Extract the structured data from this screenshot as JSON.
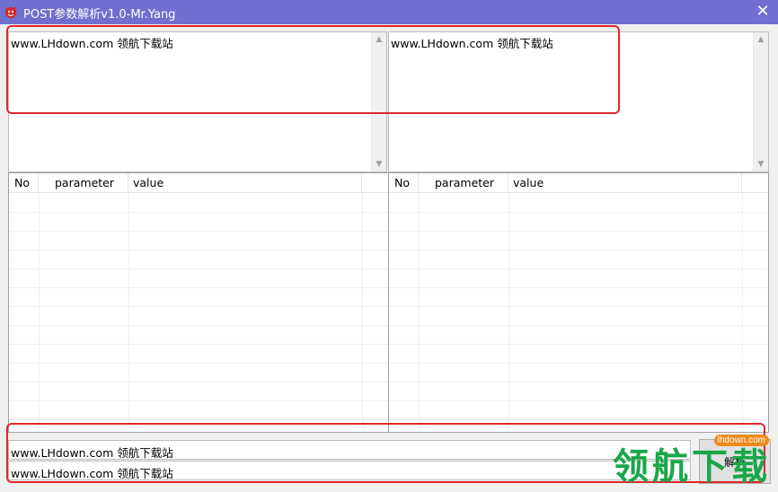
{
  "window": {
    "title": "POST参数解析v1.0-Mr.Yang",
    "close_glyph": "✕"
  },
  "input_panel": {
    "left_text": "www.LHdown.com  领航下载站",
    "right_text": "www.LHdown.com  领航下载站"
  },
  "tables": {
    "left": {
      "columns": [
        "No",
        "parameter",
        "value"
      ]
    },
    "right": {
      "columns": [
        "No",
        "parameter",
        "value"
      ]
    }
  },
  "bottom": {
    "line1": "www.LHdown.com  领航下载站",
    "line2": "www.LHdown.com  领航下载站",
    "parse_button": "解析"
  },
  "watermark": {
    "url": "lhdown.com",
    "text": "领航下载"
  },
  "colors": {
    "titlebar": "#6f6fcf",
    "highlight": "#e0262a",
    "watermark_green": "#1aa64a",
    "watermark_orange": "#f08a1c"
  },
  "icons": {
    "app": "red-devil-icon",
    "close": "close-icon",
    "scroll_up": "chevron-up-icon",
    "scroll_down": "chevron-down-icon"
  }
}
